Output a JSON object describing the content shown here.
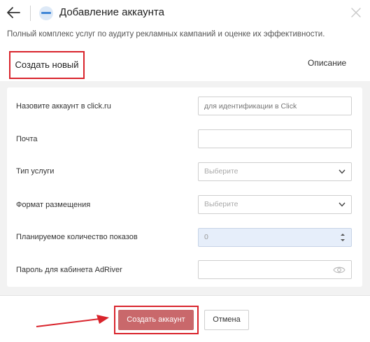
{
  "header": {
    "title": "Добавление аккаунта",
    "back_icon": "arrow-left-icon",
    "close_icon": "close-icon"
  },
  "subtitle": "Полный комплекс услуг по аудиту рекламных кампаний и оценке их эффективности.",
  "tabs": [
    {
      "label": "Создать новый",
      "active": true
    },
    {
      "label": "Описание",
      "active": false
    }
  ],
  "form": {
    "account_name": {
      "label": "Назовите аккаунт в click.ru",
      "placeholder": "для идентификации в Click",
      "value": ""
    },
    "email": {
      "label": "Почта",
      "value": ""
    },
    "service_type": {
      "label": "Тип услуги",
      "selected": "Выберите"
    },
    "placement_format": {
      "label": "Формат размещения",
      "selected": "Выберите"
    },
    "planned_impressions": {
      "label": "Планируемое количество показов",
      "value": "0"
    },
    "adriver_password": {
      "label": "Пароль для кабинета AdRiver",
      "value": ""
    }
  },
  "footer": {
    "create_label": "Создать аккаунт",
    "cancel_label": "Отмена"
  },
  "colors": {
    "highlight": "#d9242c",
    "create_button": "#c9686b",
    "disabled_field": "#e6eefa"
  }
}
